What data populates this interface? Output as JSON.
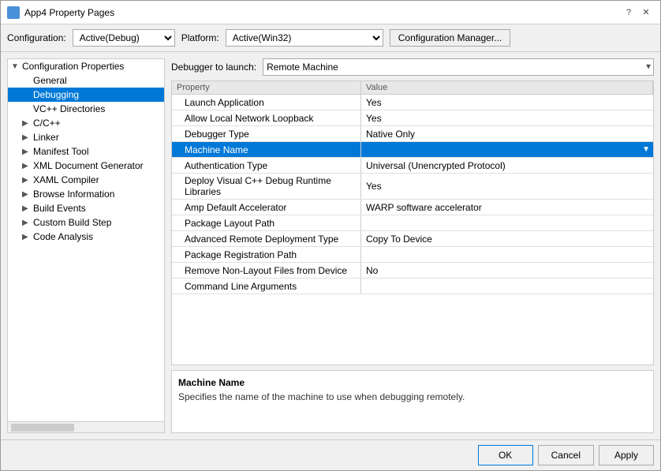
{
  "dialog": {
    "title": "App4 Property Pages",
    "title_controls": {
      "help": "?",
      "close": "✕"
    }
  },
  "config_bar": {
    "configuration_label": "Configuration:",
    "configuration_value": "Active(Debug)",
    "platform_label": "Platform:",
    "platform_value": "Active(Win32)",
    "manager_button": "Configuration Manager..."
  },
  "sidebar": {
    "items": [
      {
        "id": "config-props",
        "label": "Configuration Properties",
        "indent": 0,
        "arrow": "▼",
        "expanded": true
      },
      {
        "id": "general",
        "label": "General",
        "indent": 1,
        "arrow": "",
        "selected": false
      },
      {
        "id": "debugging",
        "label": "Debugging",
        "indent": 1,
        "arrow": "",
        "selected": true
      },
      {
        "id": "vc-dirs",
        "label": "VC++ Directories",
        "indent": 1,
        "arrow": "",
        "selected": false
      },
      {
        "id": "c-cpp",
        "label": "C/C++",
        "indent": 1,
        "arrow": "▶",
        "selected": false
      },
      {
        "id": "linker",
        "label": "Linker",
        "indent": 1,
        "arrow": "▶",
        "selected": false
      },
      {
        "id": "manifest-tool",
        "label": "Manifest Tool",
        "indent": 1,
        "arrow": "▶",
        "selected": false
      },
      {
        "id": "xml-doc-gen",
        "label": "XML Document Generator",
        "indent": 1,
        "arrow": "▶",
        "selected": false
      },
      {
        "id": "xaml-compiler",
        "label": "XAML Compiler",
        "indent": 1,
        "arrow": "▶",
        "selected": false
      },
      {
        "id": "browse-info",
        "label": "Browse Information",
        "indent": 1,
        "arrow": "▶",
        "selected": false
      },
      {
        "id": "build-events",
        "label": "Build Events",
        "indent": 1,
        "arrow": "▶",
        "selected": false
      },
      {
        "id": "custom-build",
        "label": "Custom Build Step",
        "indent": 1,
        "arrow": "▶",
        "selected": false
      },
      {
        "id": "code-analysis",
        "label": "Code Analysis",
        "indent": 1,
        "arrow": "▶",
        "selected": false
      }
    ]
  },
  "right_panel": {
    "debugger_label": "Debugger to launch:",
    "debugger_value": "Remote Machine",
    "props_table": {
      "headers": [
        "Property",
        "Value"
      ],
      "rows": [
        {
          "id": "launch-app",
          "name": "Launch Application",
          "value": "Yes",
          "selected": false,
          "has_arrow": false
        },
        {
          "id": "allow-loopback",
          "name": "Allow Local Network Loopback",
          "value": "Yes",
          "selected": false,
          "has_arrow": false
        },
        {
          "id": "debugger-type",
          "name": "Debugger Type",
          "value": "Native Only",
          "selected": false,
          "has_arrow": false
        },
        {
          "id": "machine-name",
          "name": "Machine Name",
          "value": "",
          "selected": true,
          "has_arrow": true
        },
        {
          "id": "auth-type",
          "name": "Authentication Type",
          "value": "Universal (Unencrypted Protocol)",
          "selected": false,
          "has_arrow": false
        },
        {
          "id": "deploy-libs",
          "name": "Deploy Visual C++ Debug Runtime Libraries",
          "value": "Yes",
          "selected": false,
          "has_arrow": false
        },
        {
          "id": "amp-accel",
          "name": "Amp Default Accelerator",
          "value": "WARP software accelerator",
          "selected": false,
          "has_arrow": false
        },
        {
          "id": "pkg-layout",
          "name": "Package Layout Path",
          "value": "",
          "selected": false,
          "has_arrow": false
        },
        {
          "id": "adv-remote",
          "name": "Advanced Remote Deployment Type",
          "value": "Copy To Device",
          "selected": false,
          "has_arrow": false
        },
        {
          "id": "pkg-reg",
          "name": "Package Registration Path",
          "value": "",
          "selected": false,
          "has_arrow": false
        },
        {
          "id": "remove-non-layout",
          "name": "Remove Non-Layout Files from Device",
          "value": "No",
          "selected": false,
          "has_arrow": false
        },
        {
          "id": "cmd-args",
          "name": "Command Line Arguments",
          "value": "",
          "selected": false,
          "has_arrow": false
        }
      ]
    },
    "info_panel": {
      "title": "Machine Name",
      "description": "Specifies the name of the machine to use when debugging remotely."
    }
  },
  "bottom_bar": {
    "ok": "OK",
    "cancel": "Cancel",
    "apply": "Apply"
  }
}
